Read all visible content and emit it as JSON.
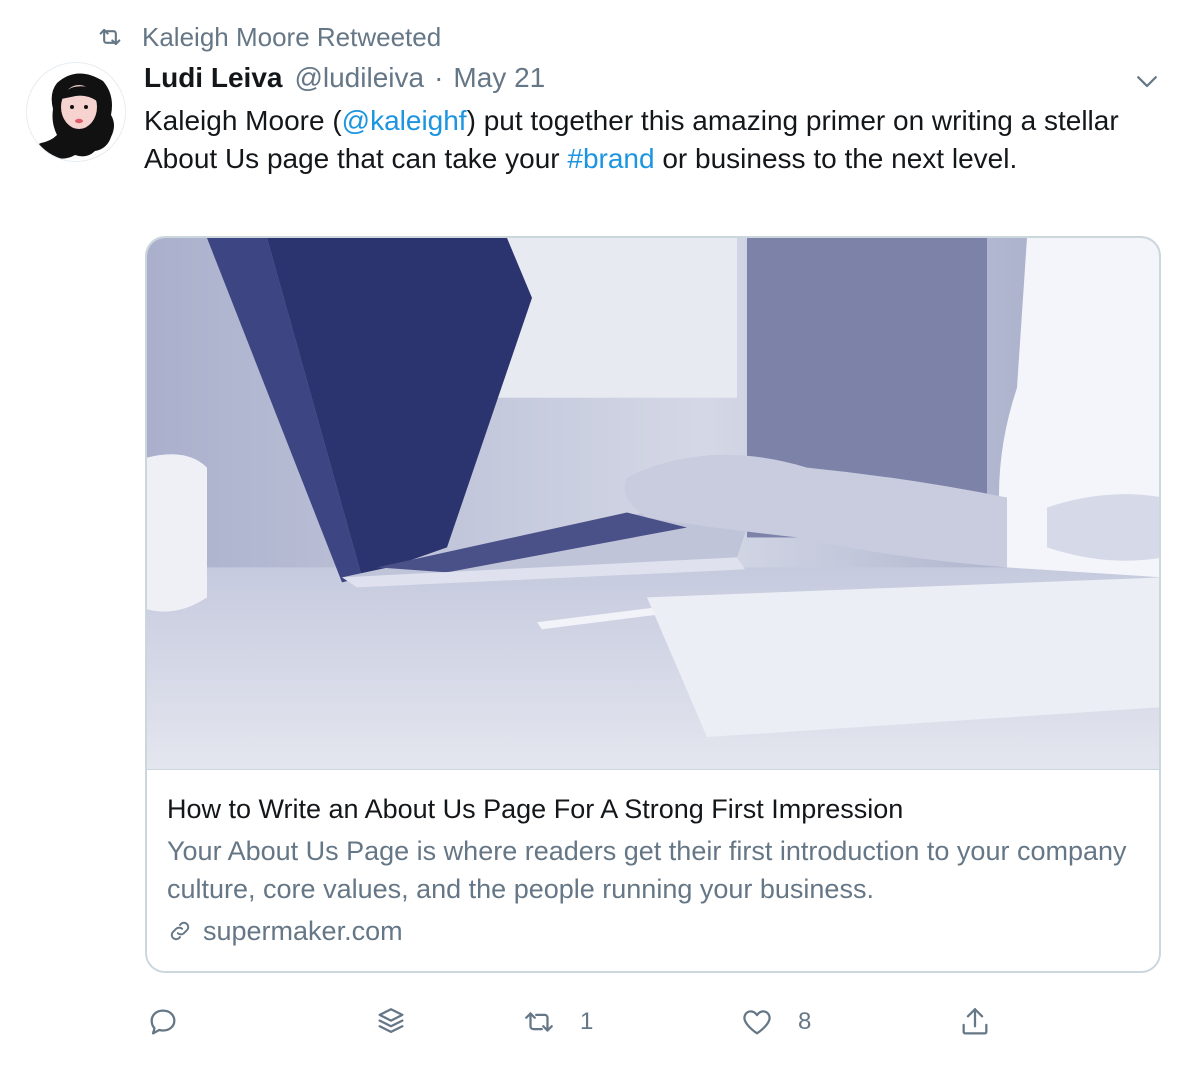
{
  "retweet_context": {
    "text": "Kaleigh Moore Retweeted",
    "icon": "retweet-icon"
  },
  "tweet": {
    "author_name": "Ludi Leiva",
    "author_handle": "@ludileiva",
    "separator": "·",
    "date": "May 21",
    "text": {
      "part1": "Kaleigh Moore (",
      "mention": "@kaleighf",
      "part2": ") put together this amazing primer on writing a stellar About Us page that can take your ",
      "hashtag": "#brand",
      "part3": " or business to the next level."
    }
  },
  "card": {
    "title": "How to Write an About Us Page For A Strong First Impression",
    "description": "Your About Us Page is where readers get their first introduction to your company culture, core values, and the people running your business.",
    "domain": "supermaker.com"
  },
  "actions": {
    "reply": {
      "icon": "reply-icon",
      "count": ""
    },
    "stack": {
      "icon": "layers-icon",
      "count": ""
    },
    "retweet": {
      "icon": "retweet-icon",
      "count": "1"
    },
    "like": {
      "icon": "heart-icon",
      "count": "8"
    },
    "share": {
      "icon": "share-icon",
      "count": ""
    }
  },
  "colors": {
    "link": "#1b95e0",
    "secondary_text": "#657786",
    "primary_text": "#14171a",
    "border": "#ccd6dd",
    "image_tint": "#3d4582"
  }
}
